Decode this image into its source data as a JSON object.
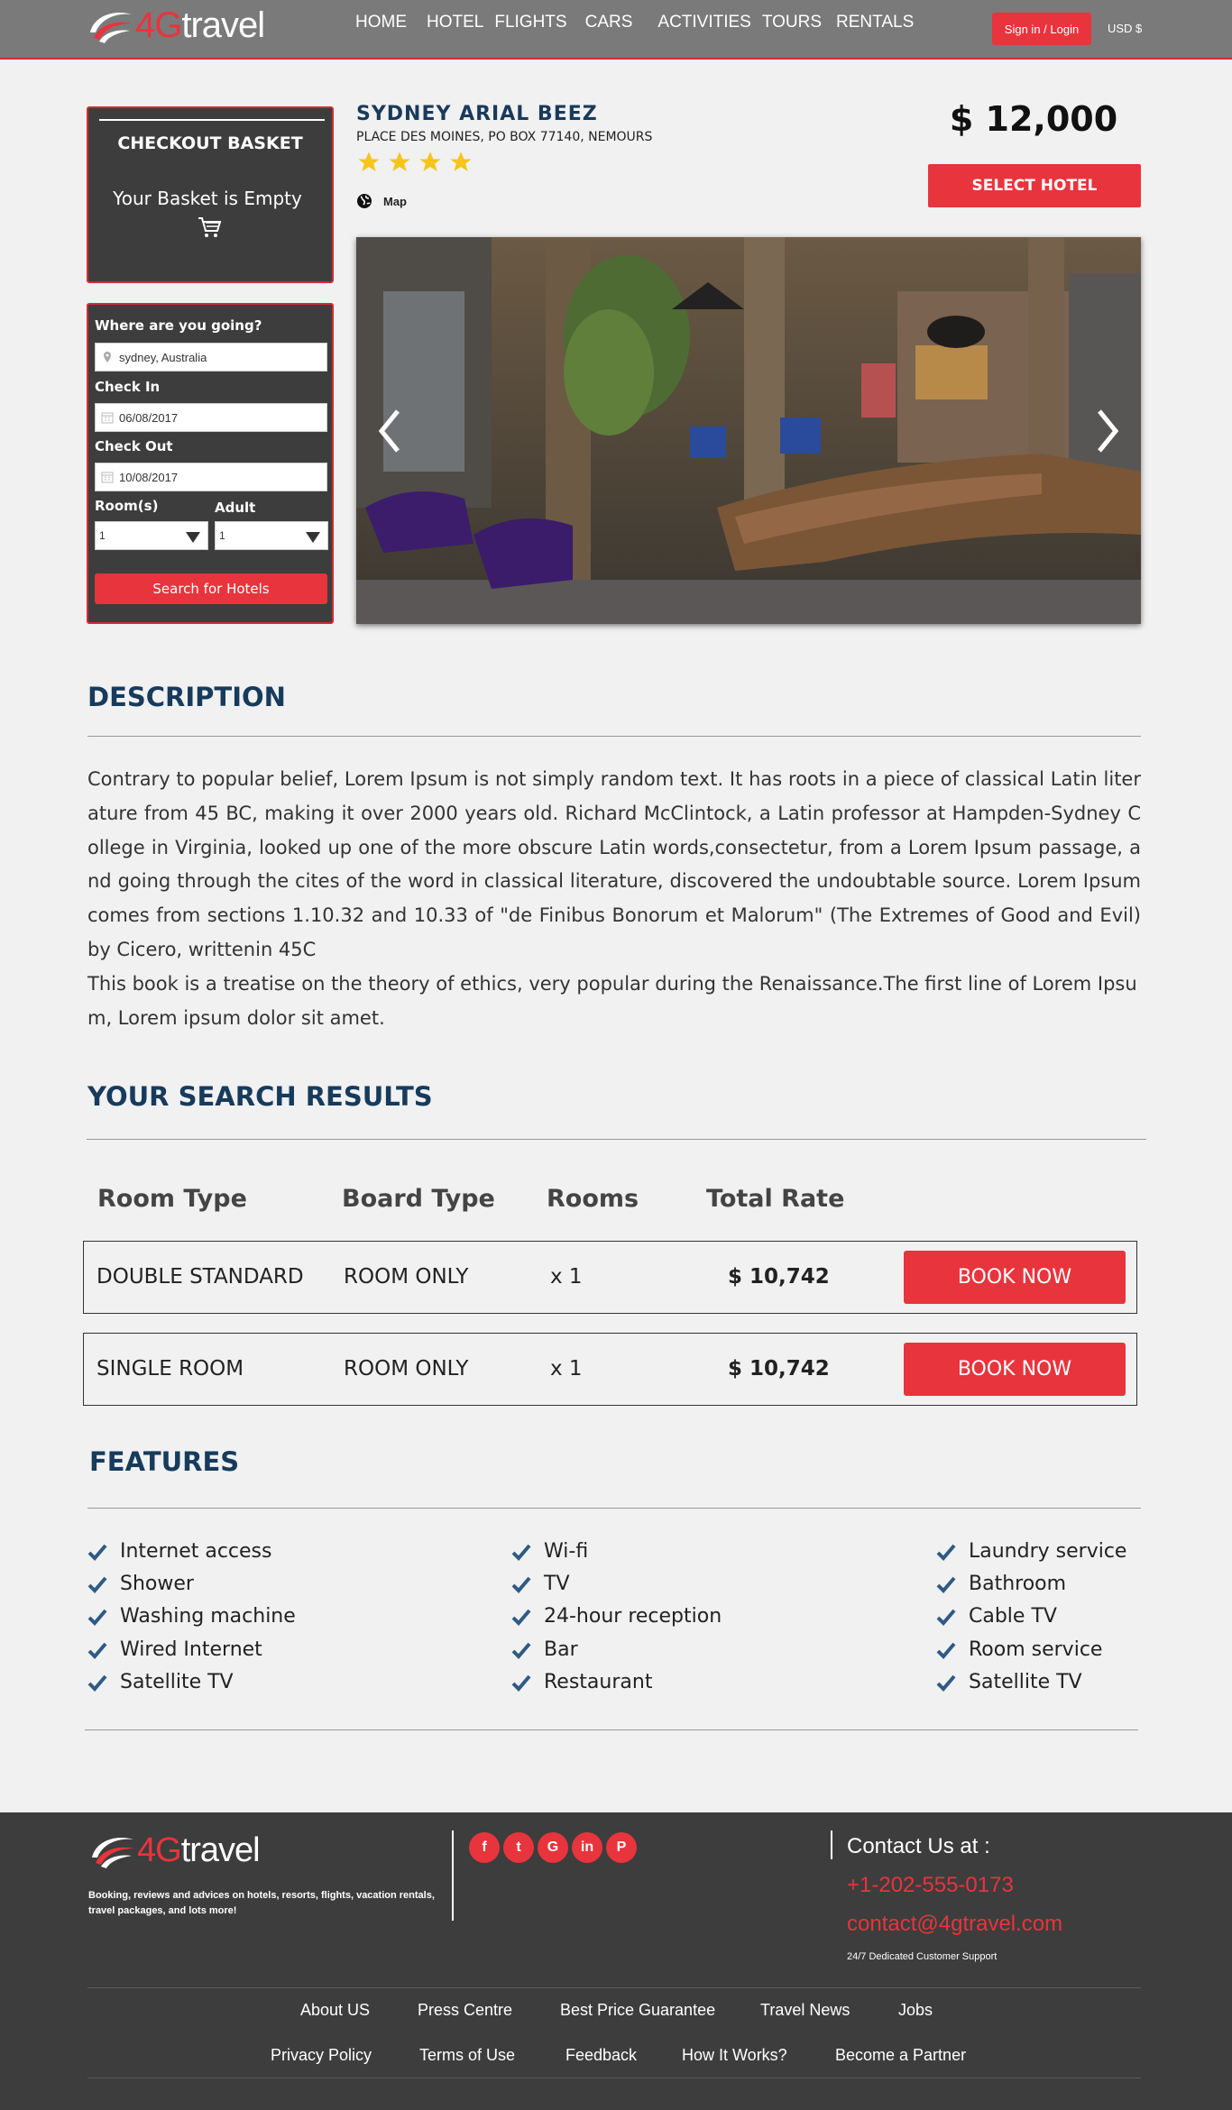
{
  "header": {
    "logo_prefix": "4G",
    "logo_suffix": "travel",
    "nav": [
      "HOME",
      "HOTEL",
      "FLIGHTS",
      "CARS",
      "ACTIVITIES",
      "TOURS",
      "RENTALS"
    ],
    "signin_label": "Sign in / Login",
    "currency": "USD $"
  },
  "basket": {
    "title": "CHECKOUT BASKET",
    "empty_text": "Your Basket is Empty",
    "icon": "shopping-cart-icon"
  },
  "search": {
    "destination_label": "Where are you going?",
    "destination_value": "sydney, Australia",
    "checkin_label": "Check In",
    "checkin_value": "06/08/2017",
    "checkout_label": "Check Out",
    "checkout_value": "10/08/2017",
    "rooms_label": "Room(s)",
    "rooms_value": "1",
    "adult_label": "Adult",
    "adult_value": "1",
    "button_label": "Search for Hotels"
  },
  "hotel": {
    "name": "SYDNEY ARIAL BEEZ",
    "address": "PLACE DES MOINES, PO BOX 77140, NEMOURS",
    "stars": 4,
    "map_label": "Map",
    "price": "$ 12,000",
    "select_label": "SELECT HOTEL"
  },
  "description": {
    "title": "DESCRIPTION",
    "text": "Contrary to popular belief, Lorem Ipsum is not simply random text. It has roots in a piece of classical Latin literature from 45 BC, making it over 2000 years old. Richard McClintock, a Latin professor at Hampden-Sydney College in Virginia, looked up one of the more obscure Latin words,consectetur, from a Lorem Ipsum passage, and going through the cites of the word in classical literature, discovered the undoubtable source. Lorem Ipsum comes from sections 1.10.32 and 10.33 of \"de Finibus Bonorum et Malorum\" (The Extremes of Good and Evil) by Cicero, writtenin 45C",
    "text2": "This book is a treatise on the theory of ethics, very popular during the Renaissance.The first line of Lorem Ipsum, Lorem ipsum dolor sit amet."
  },
  "results": {
    "title": "YOUR SEARCH RESULTS",
    "headers": [
      "Room Type",
      "Board Type",
      "Rooms",
      "Total Rate"
    ],
    "rows": [
      {
        "room": "DOUBLE STANDARD",
        "board": "ROOM ONLY",
        "rooms": "x 1",
        "rate": "$ 10,742",
        "book": "BOOK NOW"
      },
      {
        "room": "SINGLE ROOM",
        "board": "ROOM ONLY",
        "rooms": "x 1",
        "rate": "$ 10,742",
        "book": "BOOK NOW"
      }
    ]
  },
  "features": {
    "title": "FEATURES",
    "col1": [
      "Internet access",
      "Shower",
      "Washing machine",
      "Wired Internet",
      "Satellite TV"
    ],
    "col2": [
      "Wi-fi",
      " TV",
      "24-hour reception",
      "Bar",
      "Restaurant"
    ],
    "col3": [
      "Laundry service",
      "Bathroom",
      "Cable TV",
      "Room service",
      "Satellite TV"
    ]
  },
  "footer": {
    "tagline": "Booking, reviews and advices on hotels, resorts, flights, vacation rentals, travel packages, and lots more!",
    "social": [
      "facebook-icon",
      "twitter-icon",
      "google-plus-icon",
      "linkedin-icon",
      "pinterest-icon"
    ],
    "contact_heading": "Contact Us at :",
    "phone": "+1-202-555-0173",
    "email": "contact@4gtravel.com",
    "support": "24/7 Dedicated Customer Support",
    "links_row1": [
      "About US",
      "Press Centre",
      "Best Price Guarantee",
      "Travel News",
      "Jobs"
    ],
    "links_row2": [
      "Privacy Policy",
      "Terms of Use",
      "Feedback",
      "How It Works?",
      "Become a Partner"
    ]
  },
  "colors": {
    "accent": "#e8343c",
    "header_bg": "#7a7a7a",
    "panel_bg": "#3d3d3d",
    "title_blue": "#173b5c"
  }
}
